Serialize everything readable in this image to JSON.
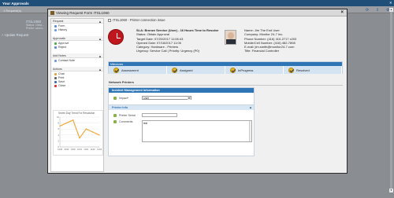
{
  "app": {
    "title": "Your Approvals",
    "close": "×",
    "requests_label": "1 Request(s)",
    "bg_item_title": "ITSL1060",
    "bg_item_status": "Status: Obta...",
    "bg_item_printer": "Printer canno...",
    "update_request": "Update Request",
    "plus": "+"
  },
  "dialog": {
    "title": "Viewing Request Form ITSL1060",
    "close": "×"
  },
  "sidebar": {
    "sections": [
      {
        "title": "Request",
        "items": [
          "Form",
          "History"
        ]
      },
      {
        "title": "Approvals",
        "items": [
          "Approve",
          "Reject"
        ]
      },
      {
        "title": "Add Notes",
        "items": [
          "Contact Note"
        ]
      },
      {
        "title": "Actions",
        "items": [
          "Chat",
          "Print",
          "Save",
          "Close"
        ]
      }
    ],
    "collapse_glyph": "▲"
  },
  "chart_data": {
    "type": "line",
    "title": "Seven Day Trend For Resolution",
    "x": [
      "10/28",
      "10/29",
      "10/30",
      "10/31",
      "11/01",
      "11/02",
      "11/03"
    ],
    "values": [
      7,
      8,
      9,
      3,
      6,
      5,
      4
    ],
    "ylim": [
      0,
      10
    ],
    "yticks": [
      "0",
      "2",
      "4",
      "6",
      "8",
      "10"
    ],
    "color": "#f2a93b"
  },
  "request": {
    "id_title": "ITSL1060 - Printer connection issue",
    "sla": "SLA: Bronze Service (User) - 16 Hours Time to Resolve",
    "status": "Status: Obtain Approval",
    "target_date": "Target Date: 07/20/2017 11:06:43",
    "opened_date": "Opened Date: 07/18/2017 11:06",
    "category": "Category: Hardware - Printers",
    "urgency": "Urgency: Service Call | Priority: Urgency (P0)",
    "contact": {
      "name": "Name: Jim The End User",
      "company": "Company: Monitor 24-7 Inc.",
      "phone": "Phone Number: (416) 410-2717 x203",
      "mobile": "Mobile/Cell Number: (416) 482-7898",
      "email": "E-mail: jim.smith@monitor24-7.com",
      "title": "Title: Financial Controller"
    }
  },
  "milestones": {
    "header": "Milestones",
    "items": [
      "Assessment",
      "Assigned",
      "InProgress",
      "Resolved"
    ]
  },
  "network_printers": {
    "label": "Network Printers"
  },
  "incident": {
    "header": "Incident Management Information",
    "impact_label": "Impact*",
    "impact_value": "User",
    "dropdown_glyph": "▼"
  },
  "printer_info": {
    "header": "Printer Info",
    "collapse_glyph": "▲",
    "serial_label": "Printer Serial",
    "serial_value": "",
    "comments_label": "Comments",
    "comments_value": "test"
  }
}
